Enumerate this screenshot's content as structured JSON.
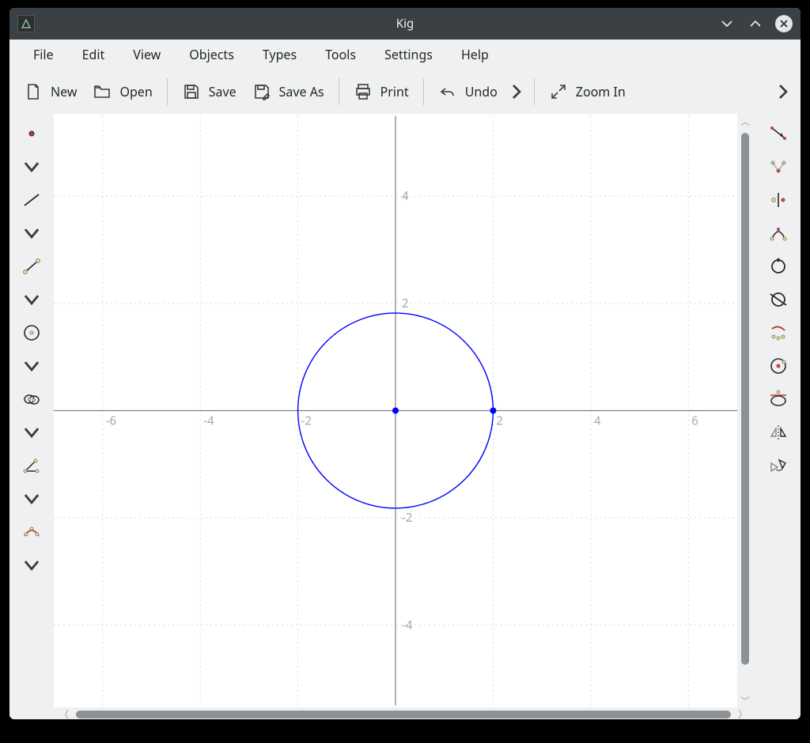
{
  "title": "Kig",
  "menubar": [
    "File",
    "Edit",
    "View",
    "Objects",
    "Types",
    "Tools",
    "Settings",
    "Help"
  ],
  "toolbar": {
    "new": "New",
    "open": "Open",
    "save": "Save",
    "save_as": "Save As",
    "print": "Print",
    "undo": "Undo",
    "zoom_in": "Zoom In"
  },
  "chart_data": {
    "type": "geometry",
    "xlim": [
      -7,
      7
    ],
    "ylim": [
      -5.5,
      5.5
    ],
    "x_ticks": [
      -6,
      -4,
      -2,
      2,
      4,
      6
    ],
    "y_ticks": [
      -4,
      -2,
      2,
      4
    ],
    "grid": true,
    "objects": [
      {
        "kind": "point",
        "x": 0,
        "y": 0,
        "color": "#0000ff"
      },
      {
        "kind": "point",
        "x": 2,
        "y": 0,
        "color": "#0000ff"
      },
      {
        "kind": "circle",
        "cx": 0,
        "cy": 0,
        "r": 2,
        "color": "#0000ff"
      }
    ]
  }
}
